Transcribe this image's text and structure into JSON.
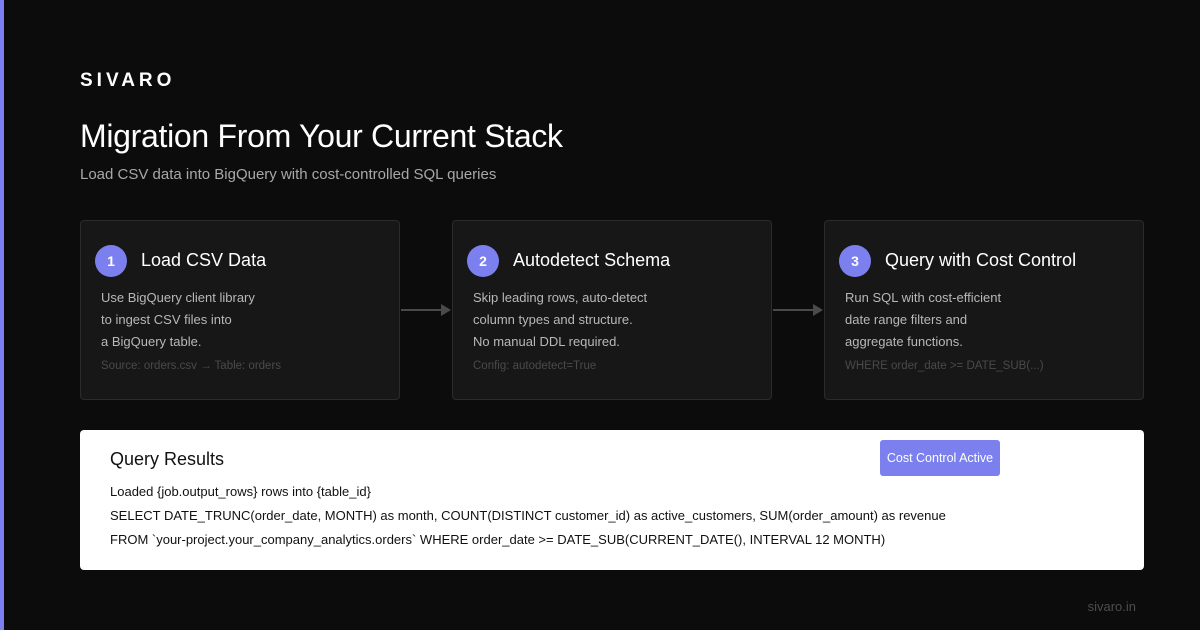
{
  "brand": "SIVARO",
  "title": "Migration From Your Current Stack",
  "subtitle": "Load CSV data into BigQuery with cost-controlled SQL queries",
  "colors": {
    "accent": "#7b80ee",
    "background": "#0c0c0c",
    "card": "#171717"
  },
  "steps": [
    {
      "number": "1",
      "title": "Load CSV Data",
      "lines": [
        "Use BigQuery client library",
        "to ingest CSV files into",
        "a BigQuery table."
      ],
      "meta": "Source: orders.csv → Table: orders"
    },
    {
      "number": "2",
      "title": "Autodetect Schema",
      "lines": [
        "Skip leading rows, auto-detect",
        "column types and structure.",
        "No manual DDL required."
      ],
      "meta": "Config: autodetect=True"
    },
    {
      "number": "3",
      "title": "Query with Cost Control",
      "lines": [
        "Run SQL with cost-efficient",
        "date range filters and",
        "aggregate functions."
      ],
      "meta": "WHERE order_date >= DATE_SUB(...)"
    }
  ],
  "results": {
    "title": "Query Results",
    "badge": "Cost Control Active",
    "lines": [
      "Loaded {job.output_rows} rows into {table_id}",
      "SELECT DATE_TRUNC(order_date, MONTH) as month, COUNT(DISTINCT customer_id) as active_customers, SUM(order_amount) as revenue",
      "FROM `your-project.your_company_analytics.orders` WHERE order_date >= DATE_SUB(CURRENT_DATE(), INTERVAL 12 MONTH)"
    ]
  },
  "footer": "sivaro.in"
}
